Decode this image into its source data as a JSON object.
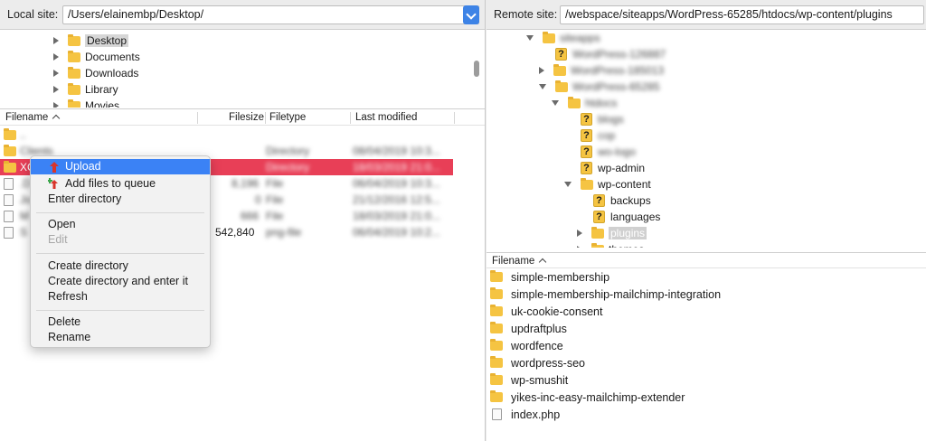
{
  "local": {
    "label": "Local site:",
    "path": "/Users/elainembp/Desktop/",
    "tree": [
      {
        "name": "Desktop",
        "selected": true
      },
      {
        "name": "Documents"
      },
      {
        "name": "Downloads"
      },
      {
        "name": "Library"
      },
      {
        "name": "Movies"
      }
    ],
    "columns": {
      "filename": "Filename",
      "filesize": "Filesize",
      "filetype": "Filetype",
      "modified": "Last modified"
    },
    "files": [
      {
        "name": "..",
        "size": "",
        "type": "",
        "modified": ""
      },
      {
        "name": "Clients",
        "size": "",
        "type": "Directory",
        "modified": "08/04/2019 10:3..."
      },
      {
        "name": "XO",
        "size": "",
        "type": "Directory",
        "modified": "18/03/2019 21:0..."
      },
      {
        "name": ".D",
        "size": "8,196",
        "type": "File",
        "modified": "06/04/2019 10:3..."
      },
      {
        "name": "Jo",
        "size": "0",
        "type": "File",
        "modified": "21/12/2016 12:5..."
      },
      {
        "name": "M",
        "size": "666",
        "type": "File",
        "modified": "18/03/2019 21:0..."
      },
      {
        "name": "S",
        "size": "542,840",
        "type": "png-file",
        "modified": "06/04/2019 10:2..."
      }
    ]
  },
  "context_menu": {
    "upload": "Upload",
    "add_to_queue": "Add files to queue",
    "enter_directory": "Enter directory",
    "open": "Open",
    "edit": "Edit",
    "create_directory": "Create directory",
    "create_directory_enter": "Create directory and enter it",
    "refresh": "Refresh",
    "delete": "Delete",
    "rename": "Rename"
  },
  "remote": {
    "label": "Remote site:",
    "path": "/webspace/siteapps/WordPress-65285/htdocs/wp-content/plugins",
    "tree": [
      {
        "name": "siteapps",
        "blur": true
      },
      {
        "name": "WordPress-126887",
        "blur": true
      },
      {
        "name": "WordPress-185013",
        "blur": true
      },
      {
        "name": "WordPress-65285",
        "blur": true
      },
      {
        "name": "htdocs",
        "blur": true
      },
      {
        "name": "blogs",
        "blur": true
      },
      {
        "name": "cop",
        "blur": true
      },
      {
        "name": "wo-logo",
        "blur": true
      },
      {
        "name": "wp-admin"
      },
      {
        "name": "wp-content"
      },
      {
        "name": "backups"
      },
      {
        "name": "languages"
      },
      {
        "name": "plugins",
        "selected": true
      },
      {
        "name": "themes"
      }
    ],
    "list_header": "Filename",
    "files": [
      {
        "name": "simple-membership",
        "kind": "folder"
      },
      {
        "name": "simple-membership-mailchimp-integration",
        "kind": "folder"
      },
      {
        "name": "uk-cookie-consent",
        "kind": "folder"
      },
      {
        "name": "updraftplus",
        "kind": "folder"
      },
      {
        "name": "wordfence",
        "kind": "folder"
      },
      {
        "name": "wordpress-seo",
        "kind": "folder"
      },
      {
        "name": "wp-smushit",
        "kind": "folder"
      },
      {
        "name": "yikes-inc-easy-mailchimp-extender",
        "kind": "folder"
      },
      {
        "name": "index.php",
        "kind": "file"
      }
    ]
  },
  "colors": {
    "highlight_row": "#e83f57",
    "menu_active": "#3b82f5",
    "folder": "#f5c442"
  }
}
